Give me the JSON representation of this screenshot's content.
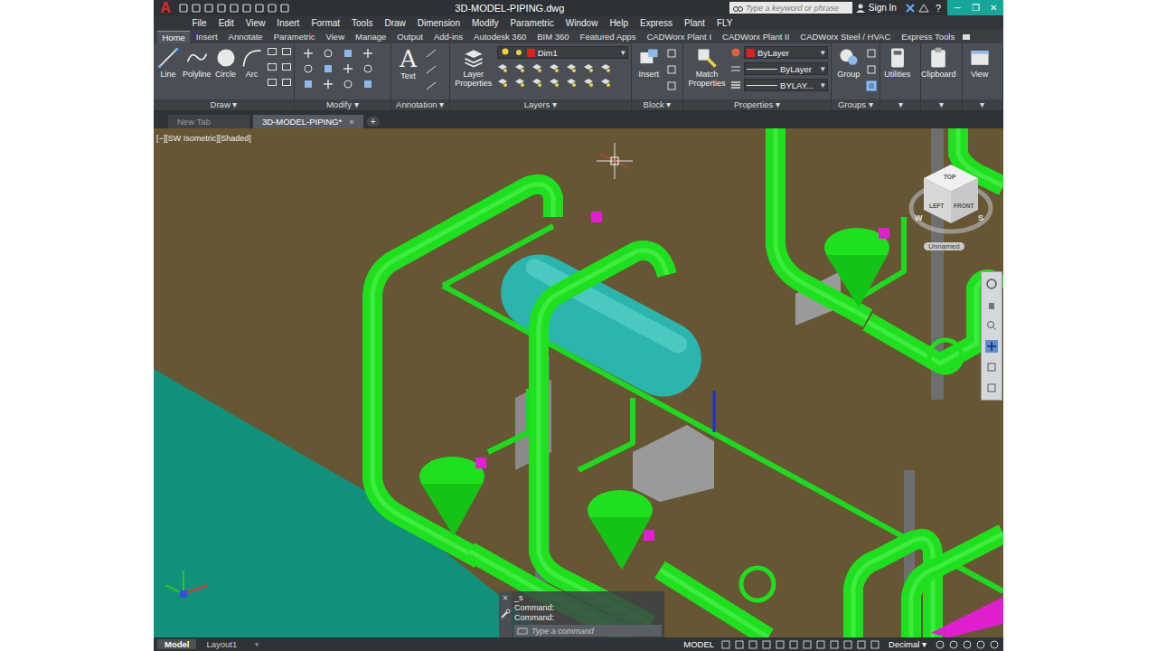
{
  "window": {
    "app_logo": "A",
    "title": "3D-MODEL-PIPING.dwg",
    "search_placeholder": "Type a keyword or phrase",
    "sign_in": "Sign In",
    "help": "?",
    "controls": [
      "─",
      "❐",
      "✕"
    ]
  },
  "menu": [
    "File",
    "Edit",
    "View",
    "Insert",
    "Format",
    "Tools",
    "Draw",
    "Dimension",
    "Modify",
    "Parametric",
    "Window",
    "Help",
    "Express",
    "Plant",
    "FLY"
  ],
  "ribbon_tabs": [
    {
      "label": "Home",
      "selected": true
    },
    {
      "label": "Insert",
      "selected": false
    },
    {
      "label": "Annotate",
      "selected": false
    },
    {
      "label": "Parametric",
      "selected": false
    },
    {
      "label": "View",
      "selected": false
    },
    {
      "label": "Manage",
      "selected": false
    },
    {
      "label": "Output",
      "selected": false
    },
    {
      "label": "Add-ins",
      "selected": false
    },
    {
      "label": "Autodesk 360",
      "selected": false
    },
    {
      "label": "BIM 360",
      "selected": false
    },
    {
      "label": "Featured Apps",
      "selected": false
    },
    {
      "label": "CADWorx Plant I",
      "selected": false
    },
    {
      "label": "CADWorx Plant II",
      "selected": false
    },
    {
      "label": "CADWorx Steel / HVAC",
      "selected": false
    },
    {
      "label": "Express Tools",
      "selected": false
    }
  ],
  "ribbon": {
    "panel_arrow": "▾",
    "draw": {
      "title": "Draw",
      "tools": [
        "Line",
        "Polyline",
        "Circle",
        "Arc"
      ]
    },
    "modify": {
      "title": "Modify"
    },
    "annotation": {
      "title": "Annotation",
      "tool": "Text",
      "tool_glyph": "A"
    },
    "layers": {
      "title": "Layers",
      "tool": "Layer Properties",
      "current_layer": "Dim1",
      "layer_color": "#e02020"
    },
    "block": {
      "title": "Block",
      "tool": "Insert"
    },
    "properties": {
      "title": "Properties",
      "tool": "Match Properties",
      "color": "ByLayer",
      "swatch": "#e02020",
      "linetype": "ByLayer",
      "lineweight": "BYLAY..."
    },
    "groups": {
      "title": "Groups",
      "tool": "Group"
    },
    "extra": [
      "Utilities",
      "Clipboard",
      "View"
    ]
  },
  "file_tabs": [
    {
      "label": "New Tab",
      "selected": false
    },
    {
      "label": "3D-MODEL-PIPING*",
      "selected": true
    }
  ],
  "file_tab_close": "×",
  "file_tab_add": "+",
  "viewport": {
    "label": "[−][SW Isometric][Shaded]",
    "viewcube": {
      "top": "TOP",
      "left": "LEFT",
      "front": "FRONT",
      "compass": [
        "W",
        "S"
      ],
      "ucs": "Unnamed"
    }
  },
  "command": {
    "history": [
      "_s",
      "Command:",
      "Command:"
    ],
    "placeholder": "Type a command",
    "close": "×"
  },
  "status": {
    "layouts": [
      {
        "label": "Model",
        "selected": true
      },
      {
        "label": "Layout1",
        "selected": false
      }
    ],
    "add": "+",
    "mode": "MODEL",
    "units": "Decimal"
  }
}
